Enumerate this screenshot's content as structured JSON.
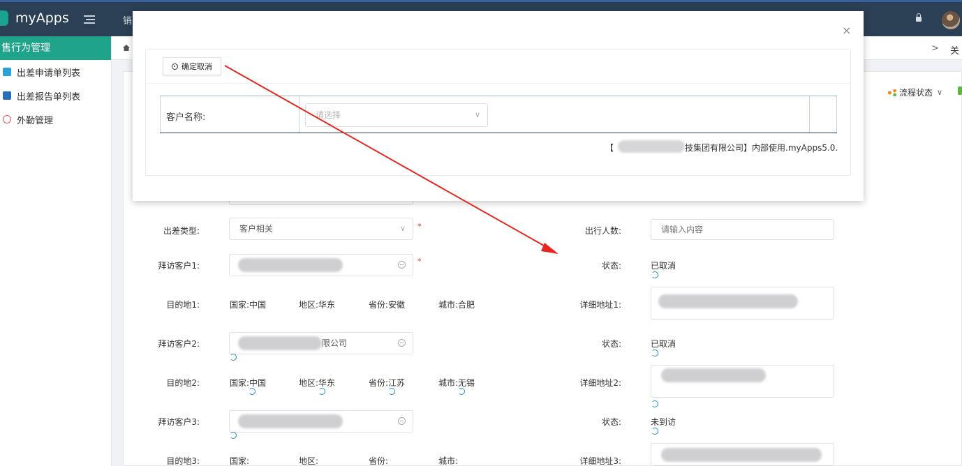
{
  "app": {
    "title": "myApps",
    "top_module": "销"
  },
  "sidebar": {
    "header": "售行为管理",
    "items": [
      {
        "label": "出差申请单列表"
      },
      {
        "label": "出差报告单列表"
      },
      {
        "label": "外勤管理"
      }
    ]
  },
  "breadcrumb": {
    "next": ">",
    "close_label": "关"
  },
  "toolbar": {
    "flow_status": "流程状态"
  },
  "modal": {
    "close": "×",
    "confirm_button": "确定取消",
    "customer_label": "客户名称:",
    "customer_placeholder": "请选择",
    "footer_open": "【",
    "footer_text": "技集团有限公司】内部使用.myApps5.0."
  },
  "form": {
    "trip_type_label": "出差类型:",
    "trip_type_value": "客户相关",
    "travelers_label": "出行人数:",
    "travelers_placeholder": "请输入内容",
    "rows": [
      {
        "visit_label": "拜访客户1:",
        "visit_value": "",
        "status_label": "状态:",
        "status_value": "已取消",
        "dest_label": "目的地1:",
        "country": "国家:中国",
        "region": "地区:华东",
        "province": "省份:安徽",
        "city": "城市:合肥",
        "address_label": "详细地址1:"
      },
      {
        "visit_label": "拜访客户2:",
        "visit_value": "限公司",
        "status_label": "状态:",
        "status_value": "已取消",
        "dest_label": "目的地2:",
        "country": "国家:中国",
        "region": "地区:华东",
        "province": "省份:江苏",
        "city": "城市:无锡",
        "address_label": "详细地址2:"
      },
      {
        "visit_label": "拜访客户3:",
        "visit_value": "",
        "status_label": "状态:",
        "status_value": "未到访",
        "dest_label": "目的地3:",
        "country": "国家:",
        "region": "地区:",
        "province": "省份:",
        "city": "城市:",
        "address_label": "详细地址3:"
      }
    ]
  },
  "colors": {
    "topbar": "#2b3f55",
    "sidebar_header": "#1fa38a",
    "arrow": "#e8261f"
  }
}
